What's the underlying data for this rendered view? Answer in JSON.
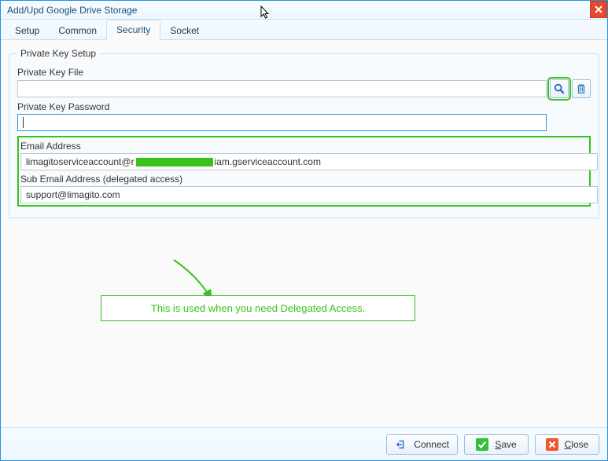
{
  "title": "Add/Upd Google Drive Storage",
  "tabs": [
    "Setup",
    "Common",
    "Security",
    "Socket"
  ],
  "active_tab": "Security",
  "groupbox_title": "Private Key Setup",
  "labels": {
    "private_key_file": "Private Key File",
    "private_key_password": "Private Key Password",
    "email_address": "Email Address",
    "sub_email": "Sub Email Address (delegated access)"
  },
  "values": {
    "private_key_file": "",
    "private_key_password": "",
    "email_prefix": "limagitoserviceaccount@r",
    "email_suffix": "iam.gserviceaccount.com",
    "sub_email": "support@limagito.com"
  },
  "callout": "This is used when you need Delegated Access.",
  "buttons": {
    "connect": "Connect",
    "save": "Save",
    "close": "Close"
  }
}
